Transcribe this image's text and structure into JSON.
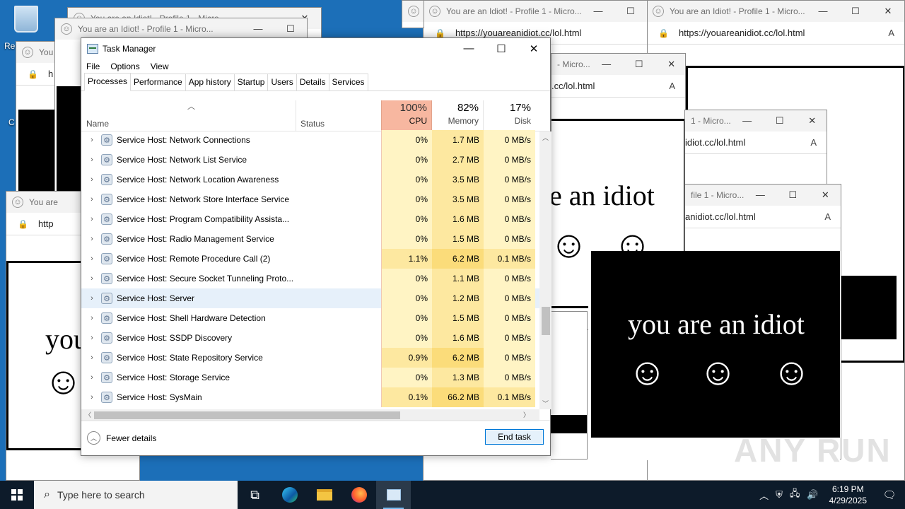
{
  "desktop": {
    "recycle_label": "Re",
    "cut_label": "C"
  },
  "browser": {
    "title": "You are an Idiot! - Profile 1 - Micro...",
    "title_short_1": "You are",
    "title_short_2": "You a",
    "title_partial": "1 - Micro...",
    "title_partial_2": "file 1 - Micro...",
    "title_partial_3": "- Micro...",
    "url": "https://youareanidiot.cc/lol.html",
    "url_partial_1": ".cc/lol.html",
    "url_partial_2": "idiot.cc/lol.html",
    "url_partial_3": "anidiot.cc/lol.html",
    "url_partial_4": "http",
    "url_partial_5": "h",
    "url_mid": "https://youareanidiot.cc/lol.h",
    "idiot_text": "you are an idiot",
    "idiot_text_partial": "e an idiot",
    "idiot_text_partial_2": "iot",
    "idiot_text_partial_3": "you",
    "smiley": "☺"
  },
  "task_manager": {
    "title": "Task Manager",
    "menu": [
      "File",
      "Options",
      "View"
    ],
    "tabs": [
      "Processes",
      "Performance",
      "App history",
      "Startup",
      "Users",
      "Details",
      "Services"
    ],
    "columns": {
      "name": "Name",
      "status": "Status",
      "cpu_pct": "100%",
      "cpu": "CPU",
      "mem_pct": "82%",
      "mem": "Memory",
      "disk_pct": "17%",
      "disk": "Disk"
    },
    "processes": [
      {
        "name": "Service Host: Network Connections",
        "cpu": "0%",
        "mem": "1.7 MB",
        "disk": "0 MB/s"
      },
      {
        "name": "Service Host: Network List Service",
        "cpu": "0%",
        "mem": "2.7 MB",
        "disk": "0 MB/s"
      },
      {
        "name": "Service Host: Network Location Awareness",
        "cpu": "0%",
        "mem": "3.5 MB",
        "disk": "0 MB/s"
      },
      {
        "name": "Service Host: Network Store Interface Service",
        "cpu": "0%",
        "mem": "3.5 MB",
        "disk": "0 MB/s"
      },
      {
        "name": "Service Host: Program Compatibility Assista...",
        "cpu": "0%",
        "mem": "1.6 MB",
        "disk": "0 MB/s"
      },
      {
        "name": "Service Host: Radio Management Service",
        "cpu": "0%",
        "mem": "1.5 MB",
        "disk": "0 MB/s"
      },
      {
        "name": "Service Host: Remote Procedure Call (2)",
        "cpu": "1.1%",
        "mem": "6.2 MB",
        "disk": "0.1 MB/s"
      },
      {
        "name": "Service Host: Secure Socket Tunneling Proto...",
        "cpu": "0%",
        "mem": "1.1 MB",
        "disk": "0 MB/s"
      },
      {
        "name": "Service Host: Server",
        "cpu": "0%",
        "mem": "1.2 MB",
        "disk": "0 MB/s"
      },
      {
        "name": "Service Host: Shell Hardware Detection",
        "cpu": "0%",
        "mem": "1.5 MB",
        "disk": "0 MB/s"
      },
      {
        "name": "Service Host: SSDP Discovery",
        "cpu": "0%",
        "mem": "1.6 MB",
        "disk": "0 MB/s"
      },
      {
        "name": "Service Host: State Repository Service",
        "cpu": "0.9%",
        "mem": "6.2 MB",
        "disk": "0 MB/s"
      },
      {
        "name": "Service Host: Storage Service",
        "cpu": "0%",
        "mem": "1.3 MB",
        "disk": "0 MB/s"
      },
      {
        "name": "Service Host: SysMain",
        "cpu": "0.1%",
        "mem": "66.2 MB",
        "disk": "0.1 MB/s"
      }
    ],
    "fewer_details": "Fewer details",
    "end_task": "End task"
  },
  "taskbar": {
    "search_placeholder": "Type here to search",
    "time": "6:19 PM",
    "date": "4/29/2025"
  },
  "watermark": "ANY RUN",
  "colors": {
    "desktop": "#1c6fb8",
    "cpu_header": "#f7b7a0",
    "heat_low": "#fff4c4",
    "heat_mid": "#fde8a0",
    "selection": "#e6f0fa",
    "accent": "#0078d7"
  }
}
